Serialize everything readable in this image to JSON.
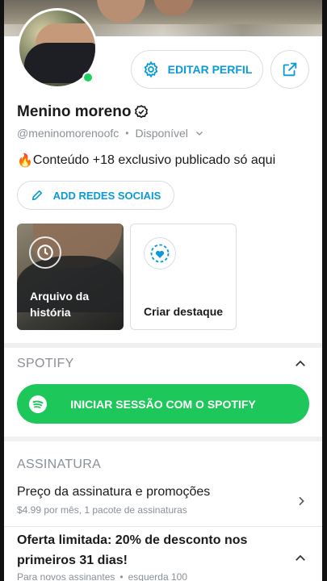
{
  "profile": {
    "name": "Menino moreno",
    "handle": "@meninomorenoofc",
    "status": "Disponível",
    "bio": "Conteúdo +18 exclusivo publicado só aqui",
    "bio_emoji": "🔥"
  },
  "actions": {
    "edit_label": "EDITAR PERFIL",
    "social_label": "ADD REDES SOCIAIS"
  },
  "highlights": {
    "archive_label_line1": "Arquivo da",
    "archive_label_line2": "história",
    "create_label": "Criar destaque"
  },
  "spotify": {
    "section_title": "SPOTIFY",
    "button_label": "INICIAR SESSÃO COM O SPOTIFY"
  },
  "subscription": {
    "section_title": "ASSINATURA",
    "price_title": "Preço da assinatura e promoções",
    "price_subtitle": "$4.99 por mês, 1 pacote de assinaturas",
    "offer_title": "Oferta limitada: 20% de desconto nos primeiros 31 dias!",
    "offer_sub_a": "Para novos assinantes",
    "offer_sub_b": "esquerda 100"
  },
  "colors": {
    "accent": "#0a9bd6",
    "spotify_green": "#1ec759",
    "online": "#1fcf5f",
    "muted": "#8a9098"
  },
  "icons": [
    "gear-icon",
    "share-icon",
    "verified-icon",
    "chevron-down-icon",
    "pencil-icon",
    "clock-icon",
    "heart-plus-icon",
    "chevron-up-icon",
    "spotify-icon",
    "chevron-right-icon"
  ]
}
